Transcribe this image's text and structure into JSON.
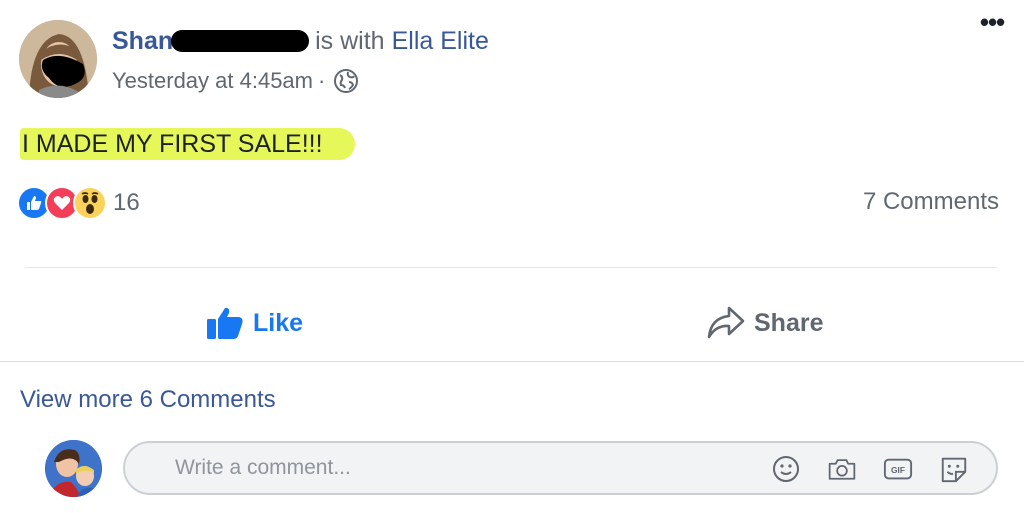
{
  "post": {
    "author_name_visible": "Shan",
    "with_text": "is with",
    "tagged_name": "Ella Elite",
    "timestamp": "Yesterday at 4:45am",
    "dot": "·",
    "privacy_icon": "globe-icon",
    "more_icon": "more-options-icon",
    "more_glyph": "•••",
    "text": "I MADE MY FIRST SALE!!!",
    "highlight_color": "#e6f75a"
  },
  "reactions": {
    "icons": [
      "like-reaction-icon",
      "love-reaction-icon",
      "wow-reaction-icon"
    ],
    "count": "16"
  },
  "comments_count": "7 Comments",
  "actions": {
    "like_label": "Like",
    "share_label": "Share"
  },
  "comments": {
    "view_more": "View more 6 Comments",
    "input_placeholder": "Write a comment...",
    "input_value": "",
    "tool_icons": [
      "emoji-icon",
      "camera-icon",
      "gif-icon",
      "sticker-icon"
    ]
  },
  "colors": {
    "link_blue": "#385898",
    "like_blue": "#1877f2",
    "love_red": "#f33e58",
    "wow_yellow": "#fcd25d",
    "secondary_text": "#616770"
  }
}
